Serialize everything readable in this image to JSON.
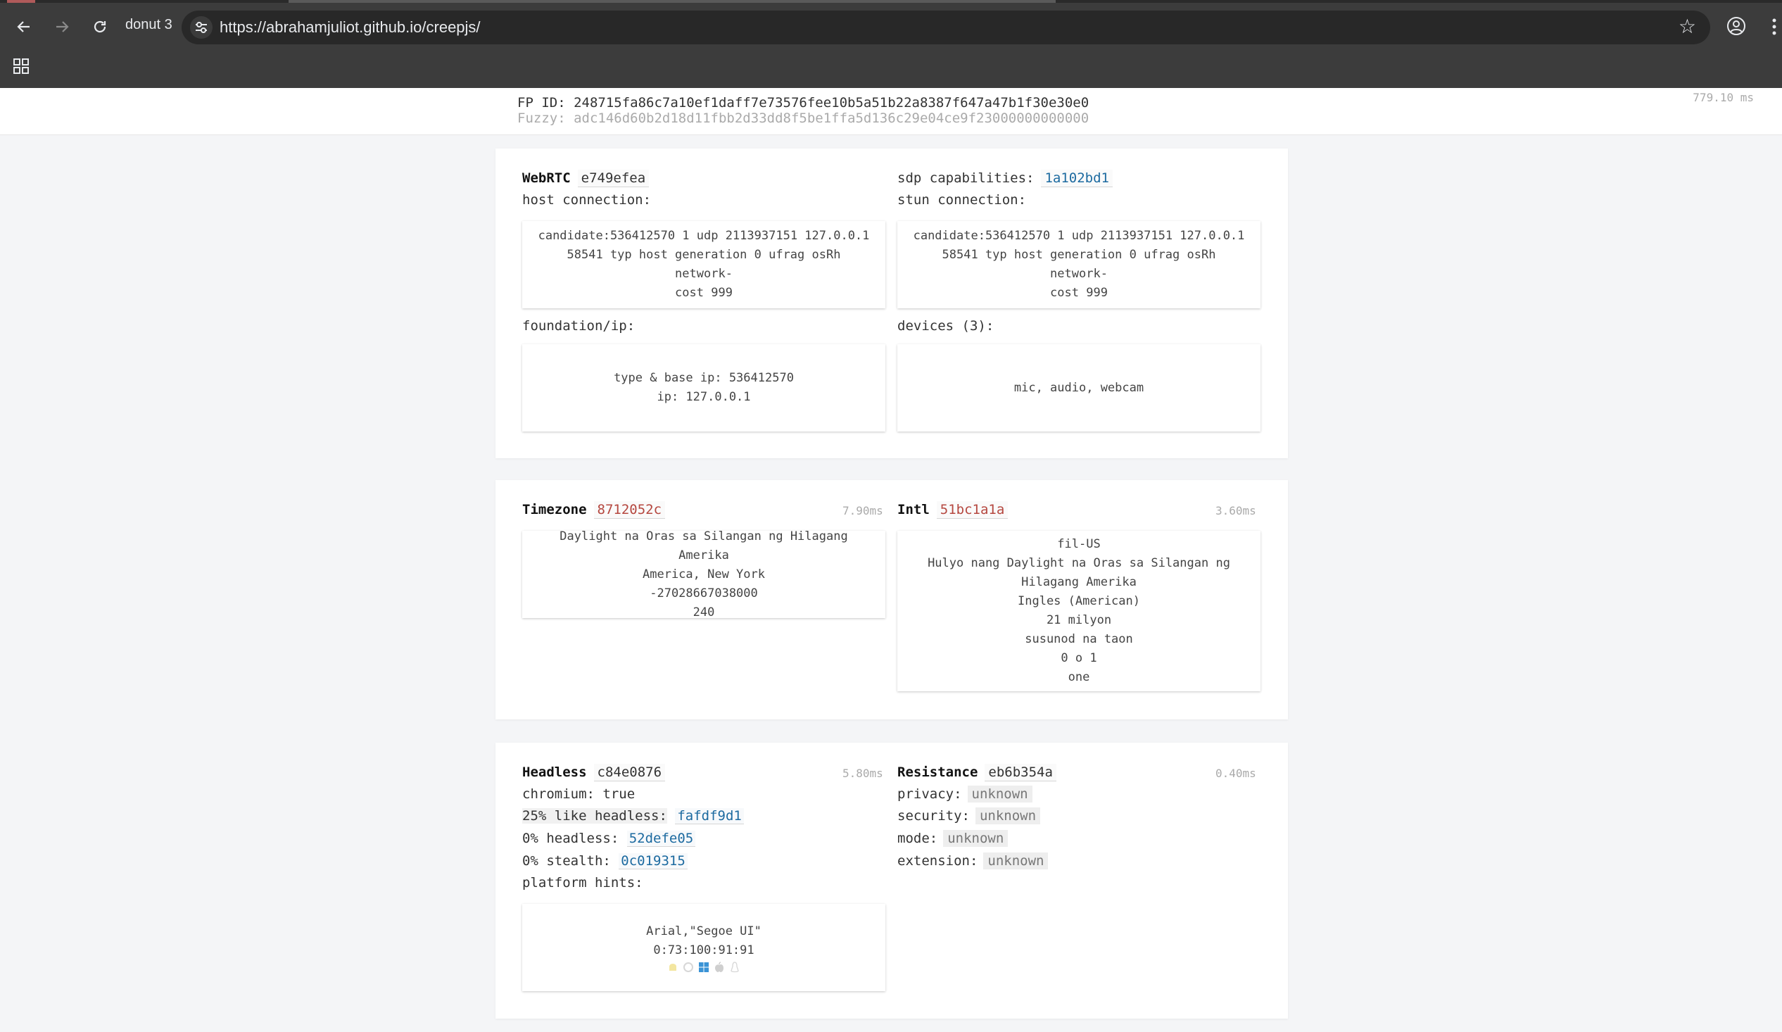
{
  "browser": {
    "tab_label": "donut 3",
    "url": "https://abrahamjuliot.github.io/creepjs/",
    "icons": [
      "back-arrow-icon",
      "forward-arrow-icon",
      "reload-icon",
      "site-settings-icon",
      "bookmark-star-icon",
      "profile-icon",
      "more-menu-icon",
      "apps-grid-icon"
    ]
  },
  "fingerprint": {
    "fp_id_label": "FP ID:",
    "fp_id_value": "248715fa86c7a10ef1daff7e73576fee10b5a51b22a8387f647a47b1f30e30e0",
    "fuzzy_label": "Fuzzy:",
    "fuzzy_value": "adc146d60b2d18d11fbb2d33dd8f5be1ffa5d136c29e04ce9f23000000000000",
    "time": "779.10 ms"
  },
  "webrtc": {
    "title": "WebRTC",
    "hash": "e749efea",
    "host_label": "host connection:",
    "host_lines": [
      "candidate:536412570 1 udp 2113937151 127.0.0.1",
      "58541 typ host generation 0 ufrag osRh network-",
      "cost 999"
    ],
    "sdp_label": "sdp capabilities:",
    "sdp_hash": "1a102bd1",
    "stun_label": "stun connection:",
    "stun_lines": [
      "candidate:536412570 1 udp 2113937151 127.0.0.1",
      "58541 typ host generation 0 ufrag osRh network-",
      "cost 999"
    ],
    "foundation_label": "foundation/ip:",
    "foundation_lines": [
      "type & base ip: 536412570",
      "ip: 127.0.0.1"
    ],
    "devices_label": "devices (3):",
    "devices_value": "mic, audio, webcam"
  },
  "timezone": {
    "title": "Timezone",
    "hash": "8712052c",
    "time": "7.90ms",
    "lines": [
      "Daylight na Oras sa Silangan ng Hilagang Amerika",
      "America, New York",
      "-27028667038000",
      "240"
    ]
  },
  "intl": {
    "title": "Intl",
    "hash": "51bc1a1a",
    "time": "3.60ms",
    "lines": [
      "fil-US",
      "Hulyo nang Daylight na Oras sa Silangan ng",
      "Hilagang Amerika",
      "Ingles (American)",
      "21 milyon",
      "susunod na taon",
      "0 o 1",
      "one"
    ]
  },
  "headless": {
    "title": "Headless",
    "hash": "c84e0876",
    "time": "5.80ms",
    "chromium": "chromium: true",
    "like_headless_label": "25% like headless:",
    "like_headless_hash": "fafdf9d1",
    "headless_label": "0% headless:",
    "headless_hash": "52defe05",
    "stealth_label": "0% stealth:",
    "stealth_hash": "0c019315",
    "platform_label": "platform hints:",
    "platform_lines": [
      "Arial,\"Segoe UI\"",
      "0:73:100:91:91"
    ],
    "platform_icons": [
      "android-icon",
      "chrome-os-icon",
      "windows-icon",
      "apple-icon",
      "linux-icon"
    ]
  },
  "resistance": {
    "title": "Resistance",
    "hash": "eb6b354a",
    "time": "0.40ms",
    "rows": [
      {
        "label": "privacy:",
        "value": "unknown"
      },
      {
        "label": "security:",
        "value": "unknown"
      },
      {
        "label": "mode:",
        "value": "unknown"
      },
      {
        "label": "extension:",
        "value": "unknown"
      }
    ]
  }
}
